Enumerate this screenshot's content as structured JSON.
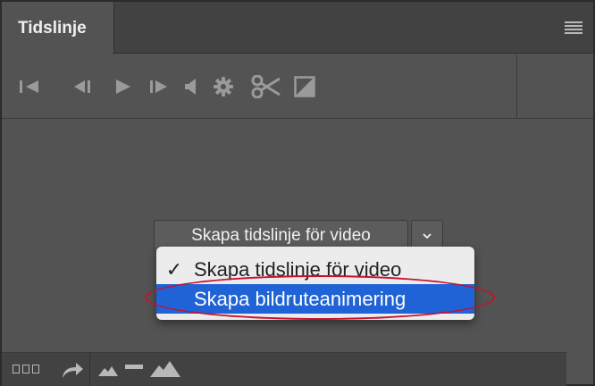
{
  "panel": {
    "tab_title": "Tidslinje"
  },
  "toolbar": {
    "icons": [
      "go-to-first-frame-icon",
      "previous-frame-icon",
      "play-icon",
      "next-frame-icon",
      "audio-icon",
      "settings-icon",
      "split-scissors-icon",
      "transition-icon"
    ]
  },
  "center": {
    "create_button_label": "Skapa tidslinje för video",
    "dropdown_arrow": "⌄"
  },
  "dropdown_menu": {
    "items": [
      {
        "label": "Skapa tidslinje för video",
        "checked": true,
        "check_glyph": "✓"
      },
      {
        "label": "Skapa bildruteanimering",
        "checked": false,
        "highlighted": true
      }
    ],
    "highlight_color": "#1f63d6",
    "annotation_ring_color": "#c8102e"
  },
  "bottom_bar": {
    "icons": [
      "frames-icon",
      "convert-arrow-icon",
      "zoom-out-mountain-icon",
      "zoom-slider-icon",
      "zoom-in-mountain-icon"
    ]
  }
}
